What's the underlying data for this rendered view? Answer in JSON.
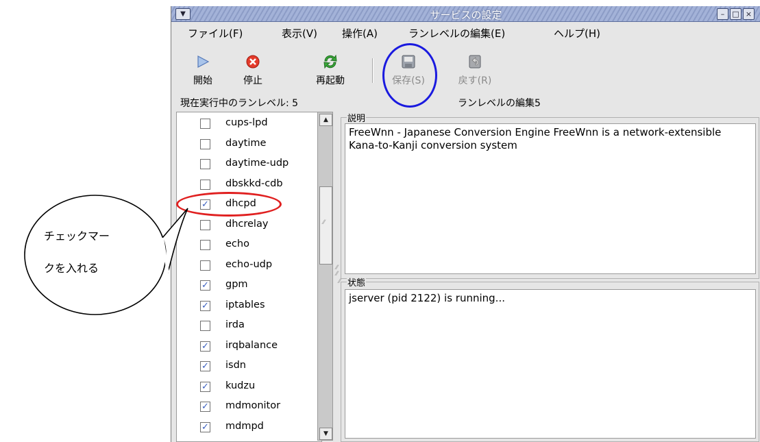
{
  "window": {
    "title": "サービスの設定",
    "system_menu_icon": "chevron-down-icon",
    "controls": [
      "minimize-icon",
      "maximize-icon",
      "close-icon"
    ]
  },
  "menubar": {
    "file": "ファイル(F)",
    "view": "表示(V)",
    "action": "操作(A)",
    "edit_runlevel": "ランレベルの編集(E)",
    "help": "ヘルプ(H)"
  },
  "toolbar": {
    "start": {
      "label": "開始",
      "icon": "play-icon"
    },
    "stop": {
      "label": "停止",
      "icon": "stop-icon"
    },
    "restart": {
      "label": "再起動",
      "icon": "restart-icon"
    },
    "save": {
      "label": "保存(S)",
      "icon": "save-icon",
      "enabled": false
    },
    "revert": {
      "label": "戻す(R)",
      "icon": "revert-icon",
      "enabled": false
    }
  },
  "status": {
    "current_runlevel": "現在実行中のランレベル: 5",
    "editing_runlevel": "ランレベルの編集5"
  },
  "services": [
    {
      "name": "cups-lpd",
      "checked": false
    },
    {
      "name": "daytime",
      "checked": false
    },
    {
      "name": "daytime-udp",
      "checked": false
    },
    {
      "name": "dbskkd-cdb",
      "checked": false
    },
    {
      "name": "dhcpd",
      "checked": true
    },
    {
      "name": "dhcrelay",
      "checked": false
    },
    {
      "name": "echo",
      "checked": false
    },
    {
      "name": "echo-udp",
      "checked": false
    },
    {
      "name": "gpm",
      "checked": true
    },
    {
      "name": "iptables",
      "checked": true
    },
    {
      "name": "irda",
      "checked": false
    },
    {
      "name": "irqbalance",
      "checked": true
    },
    {
      "name": "isdn",
      "checked": true
    },
    {
      "name": "kudzu",
      "checked": true
    },
    {
      "name": "mdmonitor",
      "checked": true
    },
    {
      "name": "mdmpd",
      "checked": true
    }
  ],
  "description": {
    "label": "説明",
    "text": "FreeWnn - Japanese Conversion Engine FreeWnn is a network-extensible Kana-to-Kanji conversion system"
  },
  "state": {
    "label": "状態",
    "text": "jserver (pid 2122) is running..."
  },
  "annotation": {
    "callout_line1": "チェックマー",
    "callout_line2": "クを入れる",
    "red_color": "#e02020",
    "blue_color": "#1a1adf"
  },
  "colors": {
    "titlebar": "#9aaad2",
    "window_bg": "#e6e6e6",
    "check_color": "#3a5fbf"
  }
}
